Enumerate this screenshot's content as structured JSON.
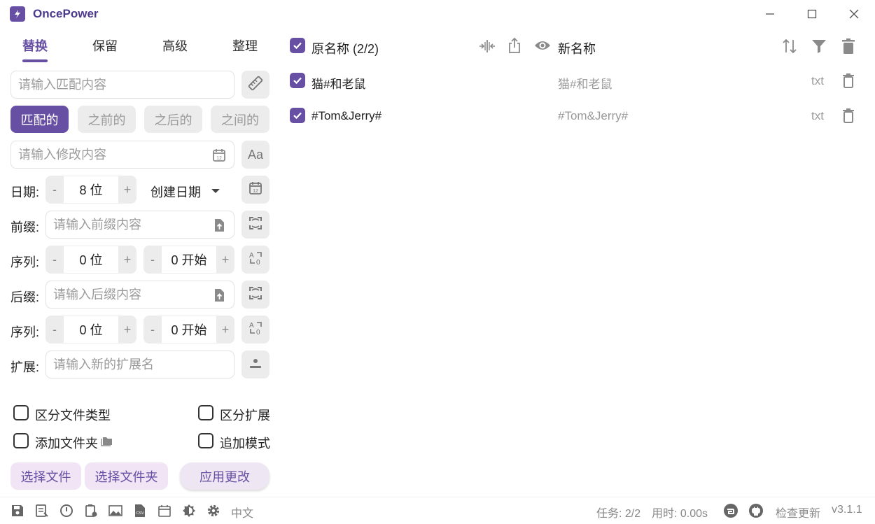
{
  "app": {
    "title": "OncePower"
  },
  "tabs": [
    {
      "label": "替换",
      "active": true
    },
    {
      "label": "保留",
      "active": false
    },
    {
      "label": "高级",
      "active": false
    },
    {
      "label": "整理",
      "active": false
    }
  ],
  "match": {
    "placeholder": "请输入匹配内容"
  },
  "segments": [
    {
      "label": "匹配的",
      "active": true
    },
    {
      "label": "之前的",
      "active": false
    },
    {
      "label": "之后的",
      "active": false
    },
    {
      "label": "之间的",
      "active": false
    }
  ],
  "modify": {
    "placeholder": "请输入修改内容",
    "case_label": "Aa"
  },
  "date": {
    "label": "日期:",
    "digits_value": "8 位",
    "minus": "-",
    "plus": "+",
    "type_value": "创建日期"
  },
  "prefix": {
    "label": "前缀:",
    "placeholder": "请输入前缀内容"
  },
  "prefix_seq": {
    "label": "序列:",
    "digits_value": "0 位",
    "start_value": "0 开始",
    "minus": "-",
    "plus": "+"
  },
  "suffix": {
    "label": "后缀:",
    "placeholder": "请输入后缀内容"
  },
  "suffix_seq": {
    "label": "序列:",
    "digits_value": "0 位",
    "start_value": "0 开始",
    "minus": "-",
    "plus": "+"
  },
  "extension": {
    "label": "扩展:",
    "placeholder": "请输入新的扩展名"
  },
  "options": {
    "distinguish_file_type": {
      "label": "区分文件类型",
      "checked": false
    },
    "distinguish_extension": {
      "label": "区分扩展",
      "checked": false
    },
    "add_folder": {
      "label": "添加文件夹",
      "checked": false
    },
    "append_mode": {
      "label": "追加模式",
      "checked": false
    }
  },
  "actions": {
    "select_files": "选择文件",
    "select_folders": "选择文件夹",
    "apply": "应用更改"
  },
  "file_list": {
    "header_original": "原名称 (2/2)",
    "header_new": "新名称",
    "rows": [
      {
        "original": "猫#和老鼠",
        "new": "猫#和老鼠",
        "ext": "txt",
        "checked": true
      },
      {
        "original": "#Tom&Jerry#",
        "new": "#Tom&Jerry#",
        "ext": "txt",
        "checked": true
      }
    ]
  },
  "statusbar": {
    "language": "中文",
    "tasks": "任务: 2/2",
    "time": "用时: 0.00s",
    "check_update": "检查更新",
    "version": "v3.1.1"
  },
  "colors": {
    "accent": "#6750a4",
    "accent_light": "#f1e4f5"
  }
}
